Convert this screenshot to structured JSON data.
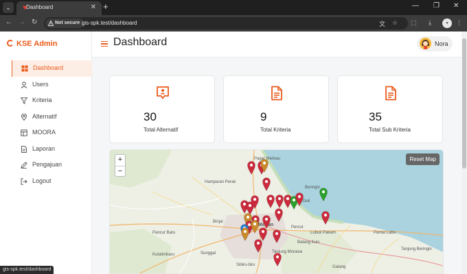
{
  "browser": {
    "tab_title": "Dashboard",
    "url_security": "Not secure",
    "url_text": "gis-spk.test/dashboard",
    "status_url": "gis-spk.test/dashboard"
  },
  "sidebar": {
    "brand": "KSE Admin",
    "items": [
      {
        "label": "Dashboard",
        "icon": "grid-icon",
        "active": true
      },
      {
        "label": "Users",
        "icon": "user-icon"
      },
      {
        "label": "Kriteria",
        "icon": "filter-icon"
      },
      {
        "label": "Alternatif",
        "icon": "map-pin-icon"
      },
      {
        "label": "MOORA",
        "icon": "table-icon"
      },
      {
        "label": "Laporan",
        "icon": "file-icon"
      },
      {
        "label": "Pengajuan",
        "icon": "pencil-icon"
      },
      {
        "label": "Logout",
        "icon": "logout-icon"
      }
    ]
  },
  "header": {
    "title": "Dashboard",
    "user_name": "Nora"
  },
  "stats": [
    {
      "value": "30",
      "label": "Total Alternatif",
      "icon": "id-card-icon"
    },
    {
      "value": "9",
      "label": "Total Kriteria",
      "icon": "document-icon"
    },
    {
      "value": "35",
      "label": "Total Sub Kriteria",
      "icon": "document-icon"
    }
  ],
  "map": {
    "zoom_in": "+",
    "zoom_out": "−",
    "reset_label": "Reset Map",
    "place_labels": [
      "Binjai",
      "Medan",
      "Tanjung Morawa",
      "Lubuk Pakam",
      "Percut",
      "Pantai Labu",
      "Batang Kuis",
      "Galang",
      "Tanjung Beringin",
      "Sunggal",
      "Kutalimbaru",
      "Hamparan Perak",
      "Labuhan Deli",
      "Pancur Batu",
      "Sibiru-biru",
      "Beringin",
      "Pagar Merbau"
    ],
    "marker_colors": {
      "red": "#cc2b3d",
      "orange": "#c98a2c",
      "green": "#2ca02c",
      "blue": "#2b7fd0"
    }
  },
  "colors": {
    "accent": "#ea5a1b",
    "sea": "#aad3df",
    "land": "#eef0e6"
  }
}
